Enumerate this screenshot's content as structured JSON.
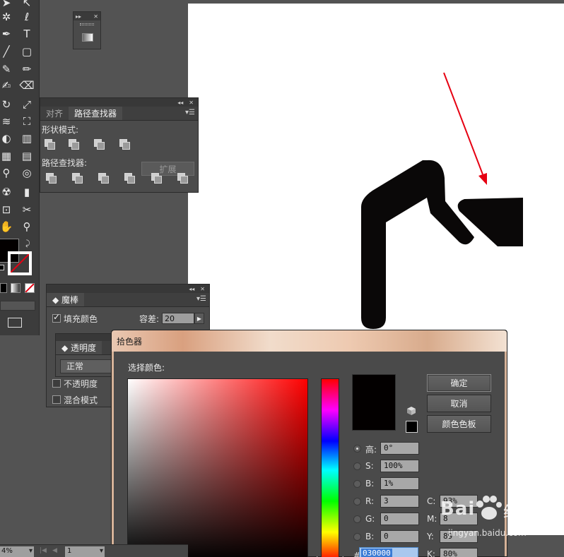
{
  "pathfinder": {
    "tabs": [
      "对齐",
      "路径查找器"
    ],
    "shape_modes_label": "形状模式:",
    "pathfinders_label": "路径查找器:",
    "expand_label": "扩展"
  },
  "magic_wand": {
    "tab": "魔棒",
    "fill_color_label": "填充颜色",
    "fill_color_checked": true,
    "tolerance_label": "容差:",
    "tolerance_value": "20",
    "opacity_label": "不透明度",
    "blend_mode_label": "混合模式"
  },
  "transparency": {
    "tab": "透明度",
    "blend_value": "正常"
  },
  "color_picker": {
    "title": "拾色器",
    "select_label": "选择颜色:",
    "preview_color": "#030000",
    "buttons": {
      "ok": "确定",
      "cancel": "取消",
      "swatches": "颜色色板"
    },
    "fields": {
      "h": {
        "label": "高:",
        "value": "0°"
      },
      "s": {
        "label": "S:",
        "value": "100%"
      },
      "b": {
        "label": "B:",
        "value": "1%"
      },
      "r": {
        "label": "R:",
        "value": "3"
      },
      "g": {
        "label": "G:",
        "value": "0"
      },
      "bl": {
        "label": "B:",
        "value": "0"
      },
      "c": {
        "label": "C:",
        "value": "93%"
      },
      "m": {
        "label": "M:",
        "value": "8"
      },
      "y": {
        "label": "Y:",
        "value": "89"
      },
      "k": {
        "label": "K:",
        "value": "80%"
      }
    },
    "hex_prefix": "#",
    "hex_value": "030000"
  },
  "status_bar": {
    "zoom": "4%",
    "page": "1"
  },
  "watermark": {
    "brand": "Bai",
    "brand_suffix": "经验",
    "url": "jingyan.baidu.com"
  },
  "colors": {
    "artwork": "#0a0808",
    "arrow": "#e60012",
    "fill_swatch": "#030000"
  }
}
